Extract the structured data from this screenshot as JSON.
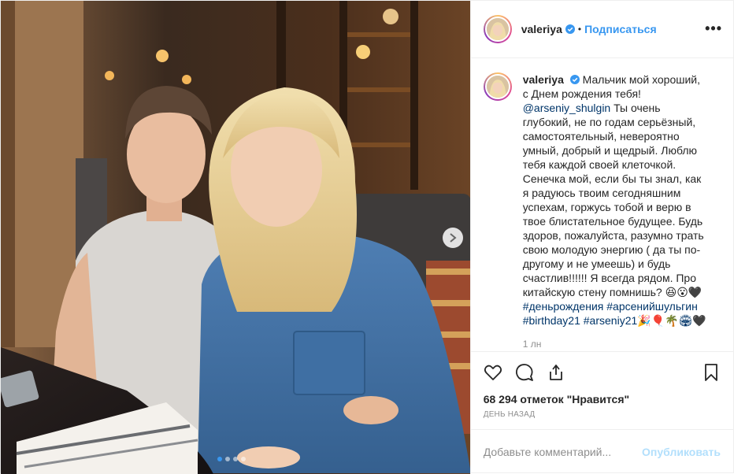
{
  "post": {
    "username": "valeriya",
    "follow_label": "Подписаться",
    "dot_separator": "•",
    "more_label": "•••",
    "caption": {
      "username": "valeriya",
      "lines": [
        {
          "type": "text",
          "value": " Мальчик мой хороший, с Днем рождения тебя!"
        },
        {
          "type": "mention",
          "value": "@arseniy_shulgin"
        },
        {
          "type": "text",
          "value": " Ты очень глубокий, не по годам серьёзный, самостоятельный, невероятно умный, добрый и щедрый. Люблю тебя каждой своей клеточкой. Сенечка мой, если бы ты знал, как я радуюсь твоим сегодняшним успехам, горжусь тобой и верю в твое блистательное будущее. Будь здоров, пожалуйста, разумно трать свою молодую энергию ( да ты по-другому и не умеешь) и будь счастлив!!!!!! Я всегда рядом. Про китайскую стену помнишь? 😆😮🖤"
        },
        {
          "type": "tag",
          "value": "#деньрождения #арсенийшульгин #birthday21 #arseniy21🎉🎈🌴🏟🖤"
        }
      ]
    },
    "time_ago": "1 лн",
    "likes_text": "68 294 отметок \"Нравится\"",
    "date_text": "ДЕНЬ НАЗАД",
    "comment_placeholder": "Добавьте комментарий...",
    "publish_label": "Опубликовать",
    "carousel": {
      "count": 4,
      "active_index": 0
    },
    "icons": {
      "like": "heart-icon",
      "comment": "comment-icon",
      "share": "share-icon",
      "save": "bookmark-icon",
      "verified": "verified-badge-icon",
      "next": "chevron-right-icon"
    },
    "colors": {
      "accent": "#3897f0",
      "link": "#003569",
      "muted": "#8e8e8e",
      "publish_disabled": "#b2dffc"
    }
  }
}
